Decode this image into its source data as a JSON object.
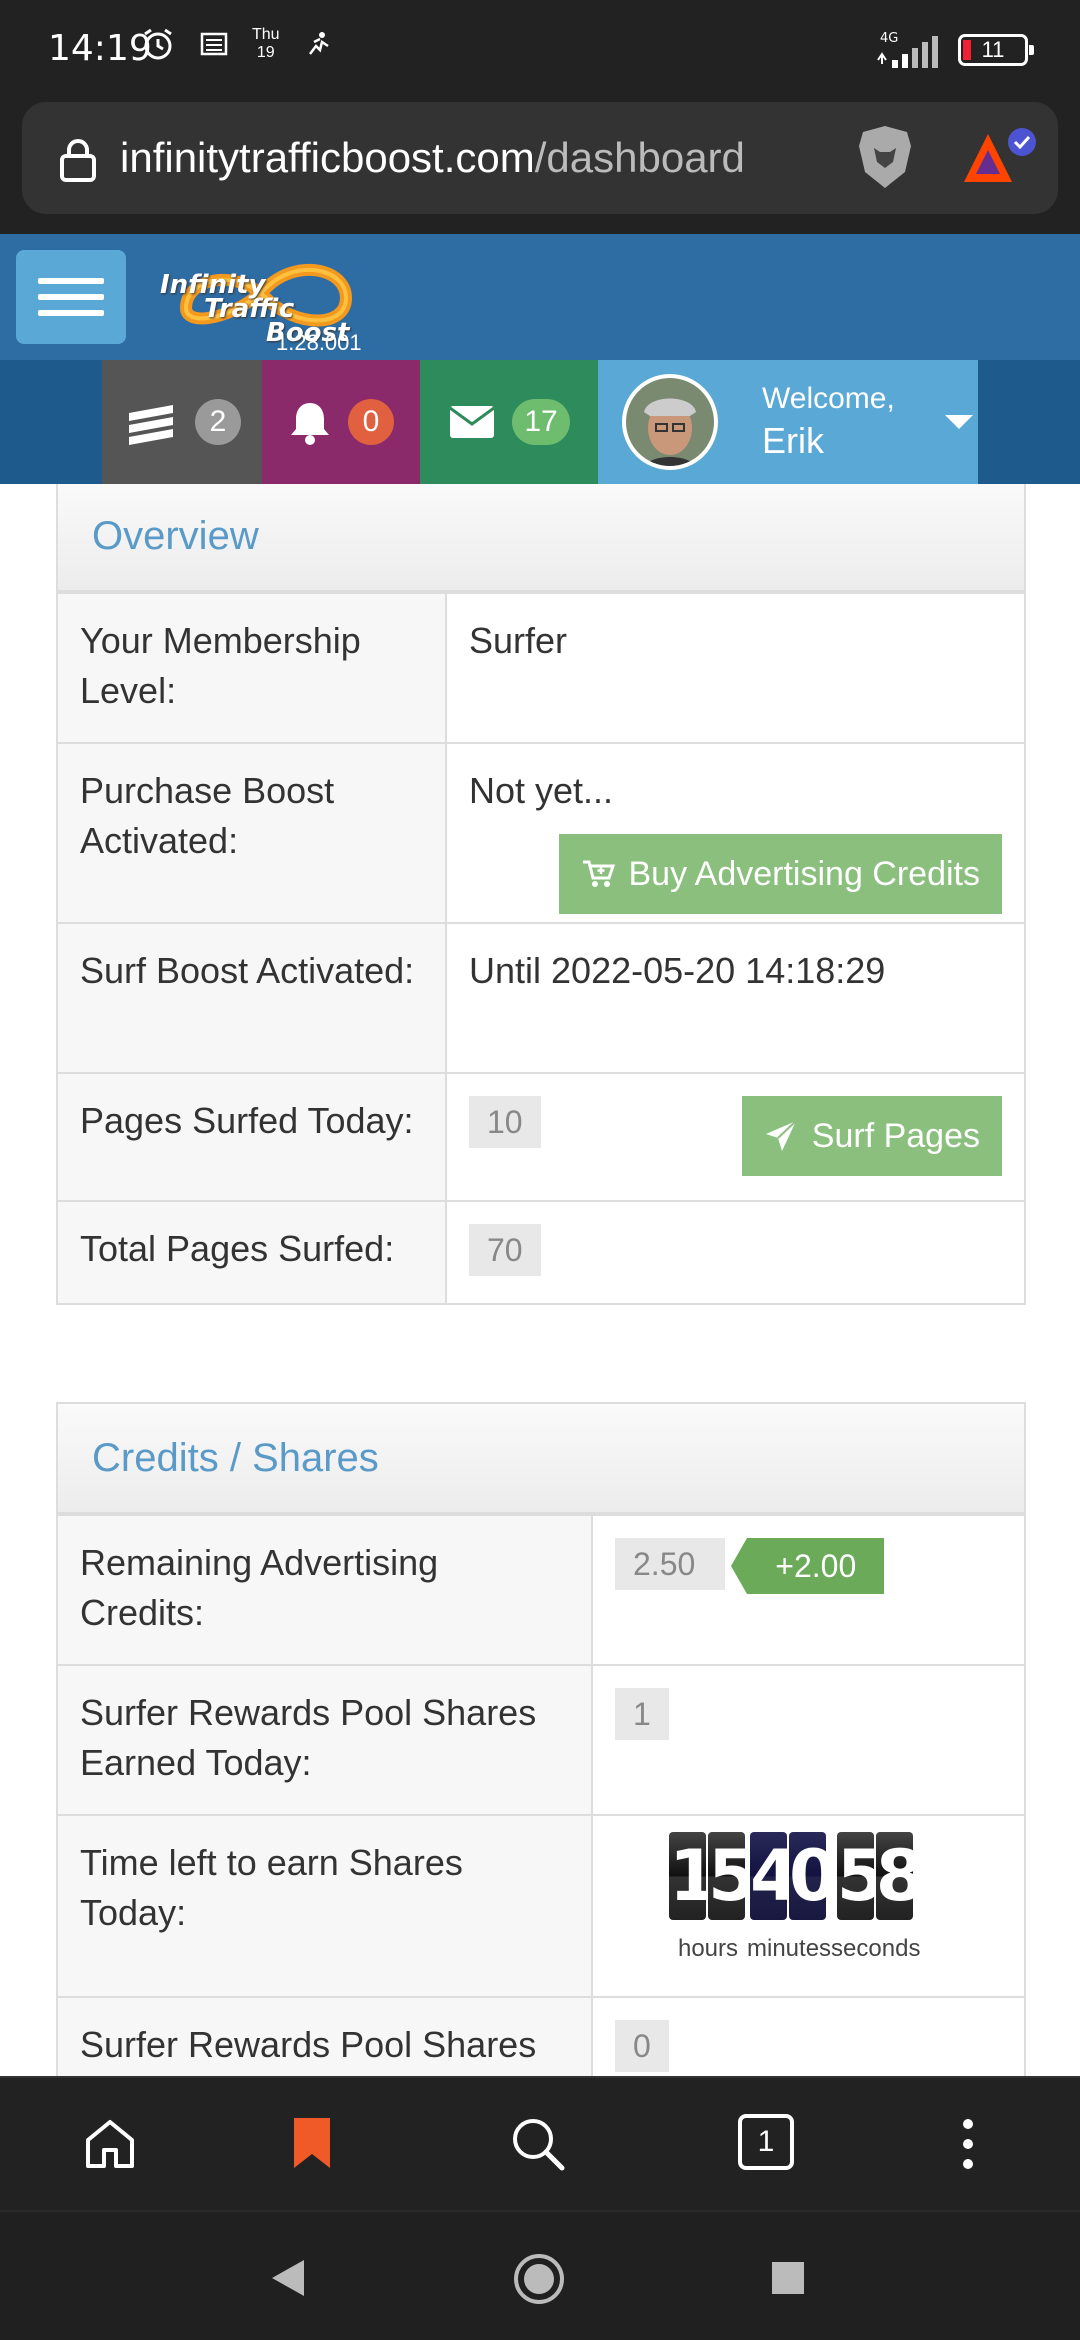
{
  "status_bar": {
    "time": "14:19",
    "day": "Thu",
    "date": "19",
    "network": "4G",
    "battery": "11"
  },
  "browser": {
    "url_domain": "infinitytrafficboost.com",
    "url_path": "/dashboard"
  },
  "header": {
    "logo_line1": "Infinity",
    "logo_line2": "Traffic",
    "logo_line3": "Boost",
    "version": "1.28.001"
  },
  "nav": {
    "surf_count": "2",
    "notifications_count": "0",
    "messages_count": "17",
    "welcome": "Welcome,",
    "user_name": "Erik"
  },
  "overview": {
    "title": "Overview",
    "rows": {
      "membership_label": "Your Membership Level:",
      "membership_value": "Surfer",
      "purchase_label": "Purchase Boost Activated:",
      "purchase_value": "Not yet...",
      "buy_button": "Buy Advertising Credits",
      "surf_boost_label": "Surf Boost Activated:",
      "surf_boost_value": "Until 2022-05-20 14:18:29",
      "pages_today_label": "Pages Surfed Today:",
      "pages_today_value": "10",
      "surf_button": "Surf Pages",
      "total_pages_label": "Total Pages Surfed:",
      "total_pages_value": "70"
    }
  },
  "credits": {
    "title": "Credits / Shares",
    "remaining_label": "Remaining Advertising Credits:",
    "remaining_value": "2.50",
    "remaining_delta": "+2.00",
    "shares_today_label": "Surfer Rewards Pool Shares Earned Today:",
    "shares_today_value": "1",
    "time_left_label": "Time left to earn Shares Today:",
    "countdown": {
      "hours": [
        "1",
        "5"
      ],
      "minutes": [
        "4",
        "0"
      ],
      "seconds": [
        "5",
        "8"
      ],
      "hours_label": "hours",
      "minutes_label": "minutes",
      "seconds_label": "seconds"
    },
    "shares_yesterday_label": "Surfer Rewards Pool Shares Earned Yesterday:",
    "shares_yesterday_value": "0"
  },
  "toolbar": {
    "tabs_count": "1"
  },
  "colors": {
    "header_blue": "#2e6da4",
    "button_green": "#8bbf7e",
    "heading_text": "#5a9ac8"
  }
}
